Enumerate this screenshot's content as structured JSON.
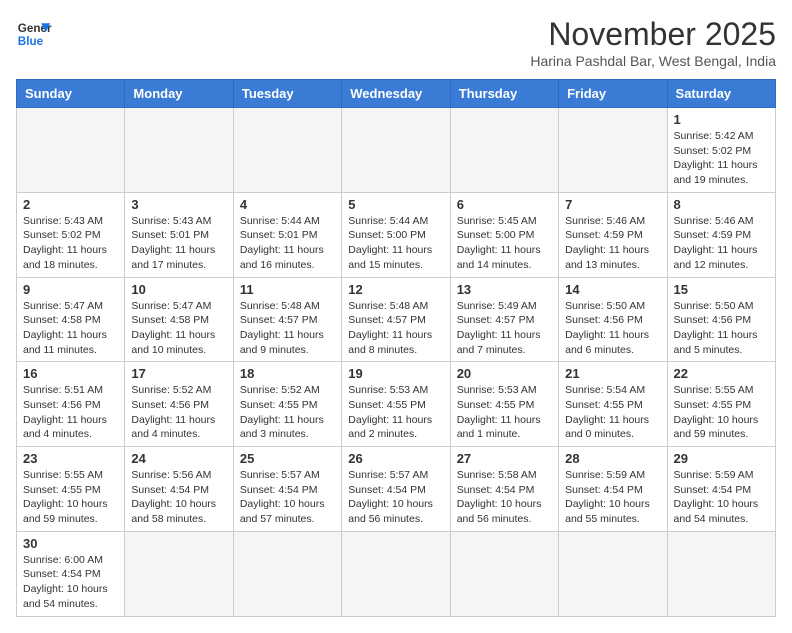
{
  "logo": {
    "line1": "General",
    "line2": "Blue"
  },
  "title": "November 2025",
  "subtitle": "Harina Pashdal Bar, West Bengal, India",
  "days_of_week": [
    "Sunday",
    "Monday",
    "Tuesday",
    "Wednesday",
    "Thursday",
    "Friday",
    "Saturday"
  ],
  "weeks": [
    [
      {
        "day": "",
        "info": ""
      },
      {
        "day": "",
        "info": ""
      },
      {
        "day": "",
        "info": ""
      },
      {
        "day": "",
        "info": ""
      },
      {
        "day": "",
        "info": ""
      },
      {
        "day": "",
        "info": ""
      },
      {
        "day": "1",
        "info": "Sunrise: 5:42 AM\nSunset: 5:02 PM\nDaylight: 11 hours and 19 minutes."
      }
    ],
    [
      {
        "day": "2",
        "info": "Sunrise: 5:43 AM\nSunset: 5:02 PM\nDaylight: 11 hours and 18 minutes."
      },
      {
        "day": "3",
        "info": "Sunrise: 5:43 AM\nSunset: 5:01 PM\nDaylight: 11 hours and 17 minutes."
      },
      {
        "day": "4",
        "info": "Sunrise: 5:44 AM\nSunset: 5:01 PM\nDaylight: 11 hours and 16 minutes."
      },
      {
        "day": "5",
        "info": "Sunrise: 5:44 AM\nSunset: 5:00 PM\nDaylight: 11 hours and 15 minutes."
      },
      {
        "day": "6",
        "info": "Sunrise: 5:45 AM\nSunset: 5:00 PM\nDaylight: 11 hours and 14 minutes."
      },
      {
        "day": "7",
        "info": "Sunrise: 5:46 AM\nSunset: 4:59 PM\nDaylight: 11 hours and 13 minutes."
      },
      {
        "day": "8",
        "info": "Sunrise: 5:46 AM\nSunset: 4:59 PM\nDaylight: 11 hours and 12 minutes."
      }
    ],
    [
      {
        "day": "9",
        "info": "Sunrise: 5:47 AM\nSunset: 4:58 PM\nDaylight: 11 hours and 11 minutes."
      },
      {
        "day": "10",
        "info": "Sunrise: 5:47 AM\nSunset: 4:58 PM\nDaylight: 11 hours and 10 minutes."
      },
      {
        "day": "11",
        "info": "Sunrise: 5:48 AM\nSunset: 4:57 PM\nDaylight: 11 hours and 9 minutes."
      },
      {
        "day": "12",
        "info": "Sunrise: 5:48 AM\nSunset: 4:57 PM\nDaylight: 11 hours and 8 minutes."
      },
      {
        "day": "13",
        "info": "Sunrise: 5:49 AM\nSunset: 4:57 PM\nDaylight: 11 hours and 7 minutes."
      },
      {
        "day": "14",
        "info": "Sunrise: 5:50 AM\nSunset: 4:56 PM\nDaylight: 11 hours and 6 minutes."
      },
      {
        "day": "15",
        "info": "Sunrise: 5:50 AM\nSunset: 4:56 PM\nDaylight: 11 hours and 5 minutes."
      }
    ],
    [
      {
        "day": "16",
        "info": "Sunrise: 5:51 AM\nSunset: 4:56 PM\nDaylight: 11 hours and 4 minutes."
      },
      {
        "day": "17",
        "info": "Sunrise: 5:52 AM\nSunset: 4:56 PM\nDaylight: 11 hours and 4 minutes."
      },
      {
        "day": "18",
        "info": "Sunrise: 5:52 AM\nSunset: 4:55 PM\nDaylight: 11 hours and 3 minutes."
      },
      {
        "day": "19",
        "info": "Sunrise: 5:53 AM\nSunset: 4:55 PM\nDaylight: 11 hours and 2 minutes."
      },
      {
        "day": "20",
        "info": "Sunrise: 5:53 AM\nSunset: 4:55 PM\nDaylight: 11 hours and 1 minute."
      },
      {
        "day": "21",
        "info": "Sunrise: 5:54 AM\nSunset: 4:55 PM\nDaylight: 11 hours and 0 minutes."
      },
      {
        "day": "22",
        "info": "Sunrise: 5:55 AM\nSunset: 4:55 PM\nDaylight: 10 hours and 59 minutes."
      }
    ],
    [
      {
        "day": "23",
        "info": "Sunrise: 5:55 AM\nSunset: 4:55 PM\nDaylight: 10 hours and 59 minutes."
      },
      {
        "day": "24",
        "info": "Sunrise: 5:56 AM\nSunset: 4:54 PM\nDaylight: 10 hours and 58 minutes."
      },
      {
        "day": "25",
        "info": "Sunrise: 5:57 AM\nSunset: 4:54 PM\nDaylight: 10 hours and 57 minutes."
      },
      {
        "day": "26",
        "info": "Sunrise: 5:57 AM\nSunset: 4:54 PM\nDaylight: 10 hours and 56 minutes."
      },
      {
        "day": "27",
        "info": "Sunrise: 5:58 AM\nSunset: 4:54 PM\nDaylight: 10 hours and 56 minutes."
      },
      {
        "day": "28",
        "info": "Sunrise: 5:59 AM\nSunset: 4:54 PM\nDaylight: 10 hours and 55 minutes."
      },
      {
        "day": "29",
        "info": "Sunrise: 5:59 AM\nSunset: 4:54 PM\nDaylight: 10 hours and 54 minutes."
      }
    ],
    [
      {
        "day": "30",
        "info": "Sunrise: 6:00 AM\nSunset: 4:54 PM\nDaylight: 10 hours and 54 minutes."
      },
      {
        "day": "",
        "info": ""
      },
      {
        "day": "",
        "info": ""
      },
      {
        "day": "",
        "info": ""
      },
      {
        "day": "",
        "info": ""
      },
      {
        "day": "",
        "info": ""
      },
      {
        "day": "",
        "info": ""
      }
    ]
  ]
}
